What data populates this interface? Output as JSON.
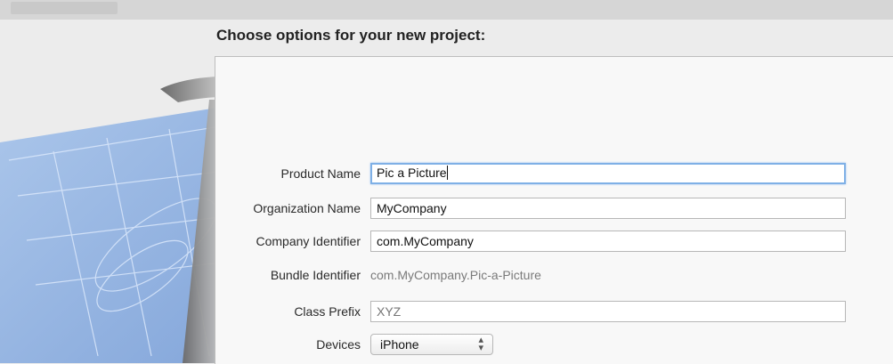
{
  "header": {
    "title": "Choose options for your new project:"
  },
  "form": {
    "product_name": {
      "label": "Product Name",
      "value": "Pic a Picture"
    },
    "organization_name": {
      "label": "Organization Name",
      "value": "MyCompany"
    },
    "company_identifier": {
      "label": "Company Identifier",
      "value": "com.MyCompany"
    },
    "bundle_identifier": {
      "label": "Bundle Identifier",
      "value": "com.MyCompany.Pic-a-Picture"
    },
    "class_prefix": {
      "label": "Class Prefix",
      "placeholder": "XYZ"
    },
    "devices": {
      "label": "Devices",
      "selected": "iPhone"
    }
  },
  "colors": {
    "focus_ring": "#7fb0e6",
    "blueprint": "#8fb3e3"
  },
  "icons": {
    "devices_select_arrows": "up-down-chevron-icon",
    "xcode_artwork": "hammer-blueprint-icon"
  }
}
